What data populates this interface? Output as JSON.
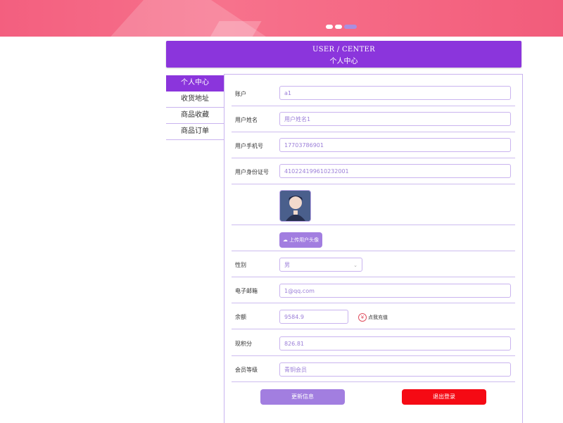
{
  "banner": {
    "carousel_dots": 3,
    "active_dot": 3
  },
  "header": {
    "title_en": "USER / CENTER",
    "title_cn": "个人中心"
  },
  "sidebar": {
    "items": [
      {
        "label": "个人中心",
        "active": true
      },
      {
        "label": "收货地址",
        "active": false
      },
      {
        "label": "商品收藏",
        "active": false
      },
      {
        "label": "商品订单",
        "active": false
      }
    ]
  },
  "form": {
    "account": {
      "label": "账户",
      "value": "a1"
    },
    "username": {
      "label": "用户姓名",
      "value": "用户姓名1"
    },
    "phone": {
      "label": "用户手机号",
      "value": "17703786901"
    },
    "idcard": {
      "label": "用户身份证号",
      "value": "410224199610232001"
    },
    "avatar": {
      "alt": "用户头像"
    },
    "upload": {
      "label": "上传用户头像"
    },
    "gender": {
      "label": "性别",
      "value": "男"
    },
    "email": {
      "label": "电子邮箱",
      "value": "1@qq.com"
    },
    "balance": {
      "label": "余额",
      "value": "9584.9",
      "recharge_label": "点我充值"
    },
    "points": {
      "label": "现积分",
      "value": "826.81"
    },
    "level": {
      "label": "会员等级",
      "value": "青铜会员"
    }
  },
  "actions": {
    "update_label": "更新信息",
    "logout_label": "退出登录"
  },
  "colors": {
    "banner": "#f35f7f",
    "accent": "#8b35dc",
    "button": "#a27ee0",
    "logout": "#f50a14"
  }
}
